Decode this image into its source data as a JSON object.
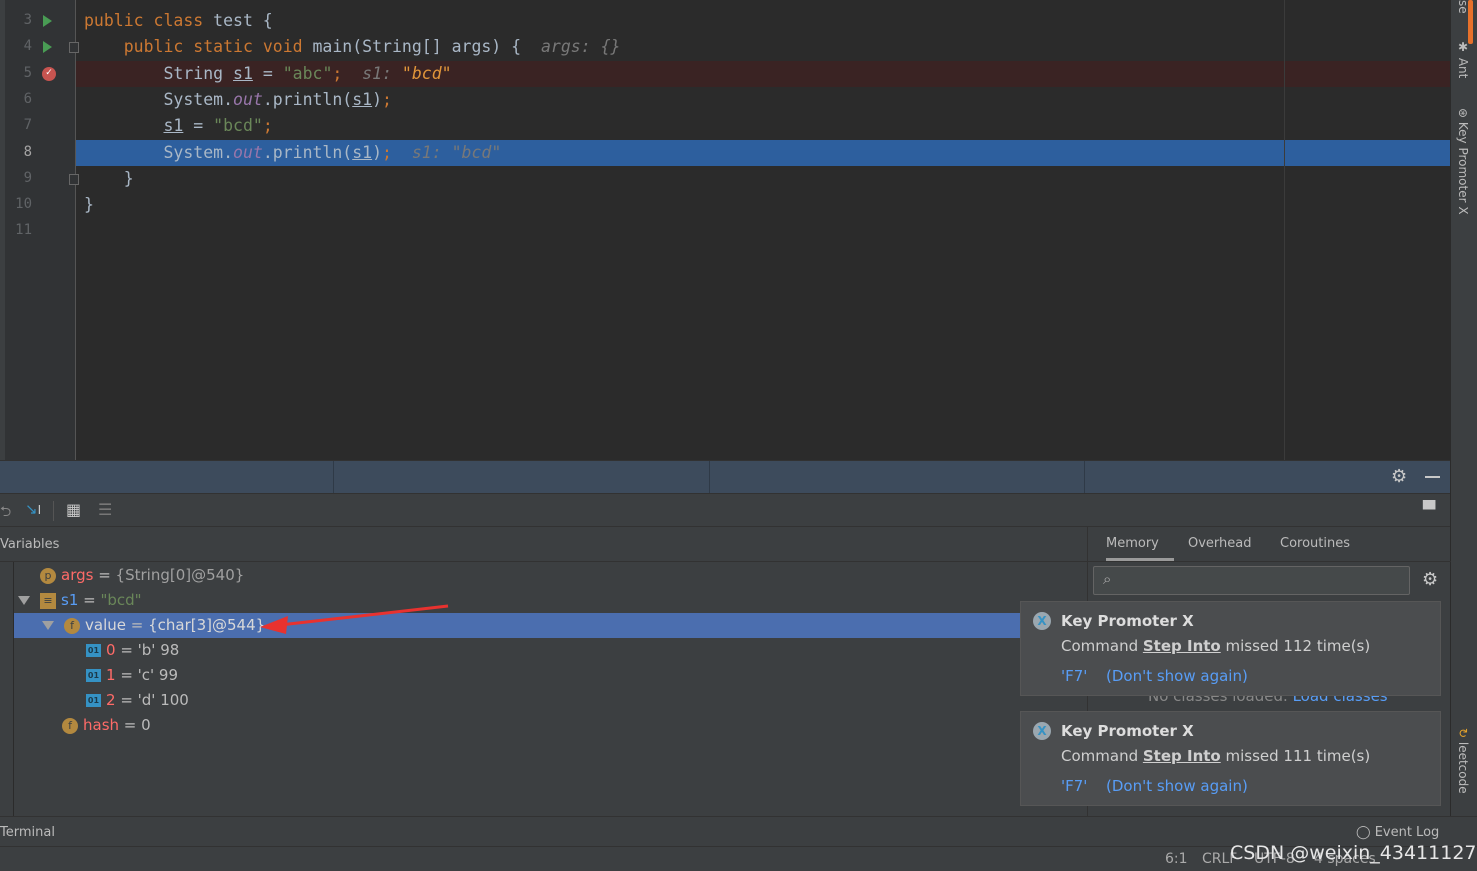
{
  "editor": {
    "lines": [
      {
        "num": "3",
        "run": true,
        "tokens": [
          [
            "kw",
            "public class "
          ],
          [
            "",
            "test {"
          ]
        ]
      },
      {
        "num": "4",
        "run": true,
        "fold": true,
        "tokens": [
          [
            "",
            "    "
          ],
          [
            "kw",
            "public static void "
          ],
          [
            "",
            "main(String[] args) {  "
          ],
          [
            "hint",
            "args: {}"
          ]
        ]
      },
      {
        "num": "5",
        "breakpoint": true,
        "bg": "bp",
        "tokens": [
          [
            "",
            "        String "
          ],
          [
            "u",
            "s1"
          ],
          [
            "",
            " = "
          ],
          [
            "str",
            "\"abc\""
          ],
          [
            "kw",
            ";"
          ],
          [
            "hint",
            "  s1: "
          ],
          [
            "chg",
            "\"bcd\""
          ]
        ]
      },
      {
        "num": "6",
        "tokens": [
          [
            "",
            "        System."
          ],
          [
            "fld",
            "out"
          ],
          [
            "",
            ".println("
          ],
          [
            "u",
            "s1"
          ],
          [
            "",
            ")"
          ],
          [
            "kw",
            ";"
          ]
        ]
      },
      {
        "num": "7",
        "tokens": [
          [
            "",
            "        "
          ],
          [
            "u",
            "s1"
          ],
          [
            "",
            " = "
          ],
          [
            "str",
            "\"bcd\""
          ],
          [
            "kw",
            ";"
          ]
        ]
      },
      {
        "num": "8",
        "current": true,
        "bg": "exec",
        "tokens": [
          [
            "",
            "        System."
          ],
          [
            "fld",
            "out"
          ],
          [
            "",
            ".println("
          ],
          [
            "u",
            "s1"
          ],
          [
            "",
            ")"
          ],
          [
            "kw",
            ";"
          ],
          [
            "hint",
            "  s1: \"bcd\""
          ]
        ]
      },
      {
        "num": "9",
        "fold": true,
        "tokens": [
          [
            "",
            "    }"
          ]
        ]
      },
      {
        "num": "10",
        "tokens": [
          [
            "",
            "}"
          ]
        ]
      },
      {
        "num": "11",
        "tokens": []
      }
    ]
  },
  "right_stripe": {
    "items": [
      "se",
      "Ant",
      "Key Promoter X",
      "leetcode"
    ]
  },
  "debugger": {
    "variables_label": "Variables",
    "tree": [
      {
        "badge": "p",
        "name": "args",
        "eq": " = ",
        "value": "{String[0]@540}",
        "style": "gr"
      },
      {
        "badge": "list",
        "name": "s1",
        "eq": " = ",
        "value": "\"bcd\"",
        "style": "sg",
        "expanded": true,
        "blue": true
      },
      {
        "badge": "f",
        "name": "value",
        "eq": " = ",
        "value": "{char[3]@544}",
        "style": "gr",
        "expanded": true,
        "selected": true
      },
      {
        "badge": "01",
        "name": "0",
        "eq": " = ",
        "value": "'b' 98"
      },
      {
        "badge": "01",
        "name": "1",
        "eq": " = ",
        "value": "'c' 99"
      },
      {
        "badge": "01",
        "name": "2",
        "eq": " = ",
        "value": "'d' 100"
      },
      {
        "badge": "f",
        "name": "hash",
        "eq": " = ",
        "value": "0"
      }
    ],
    "tabs": [
      "Memory",
      "Overhead",
      "Coroutines"
    ],
    "search_placeholder": "",
    "memory_empty": "No classes loaded.",
    "memory_load": "Load classes"
  },
  "notifications": [
    {
      "title": "Key Promoter X",
      "cmd_prefix": "Command ",
      "cmd": "Step Into",
      "cmd_suffix": " missed 112 time(s)",
      "shortcut": "'F7'",
      "dismiss": "(Don't show again)"
    },
    {
      "title": "Key Promoter X",
      "cmd_prefix": "Command ",
      "cmd": "Step Into",
      "cmd_suffix": " missed 111 time(s)",
      "shortcut": "'F7'",
      "dismiss": "(Don't show again)"
    }
  ],
  "bottom": {
    "terminal": "Terminal",
    "event_log": "Event Log"
  },
  "status": {
    "position": "6:1",
    "line_sep": "CRLF",
    "encoding": "UTF-8",
    "indent": "4 spaces",
    "watermark": "CSDN @weixin_43411127"
  },
  "colors": {
    "keyword": "#cc7832",
    "string": "#6a8759",
    "exec_line": "#2d5f9e",
    "breakpoint_line": "#3a2323",
    "selection": "#4b6eaf",
    "arrow": "#e8322f"
  }
}
